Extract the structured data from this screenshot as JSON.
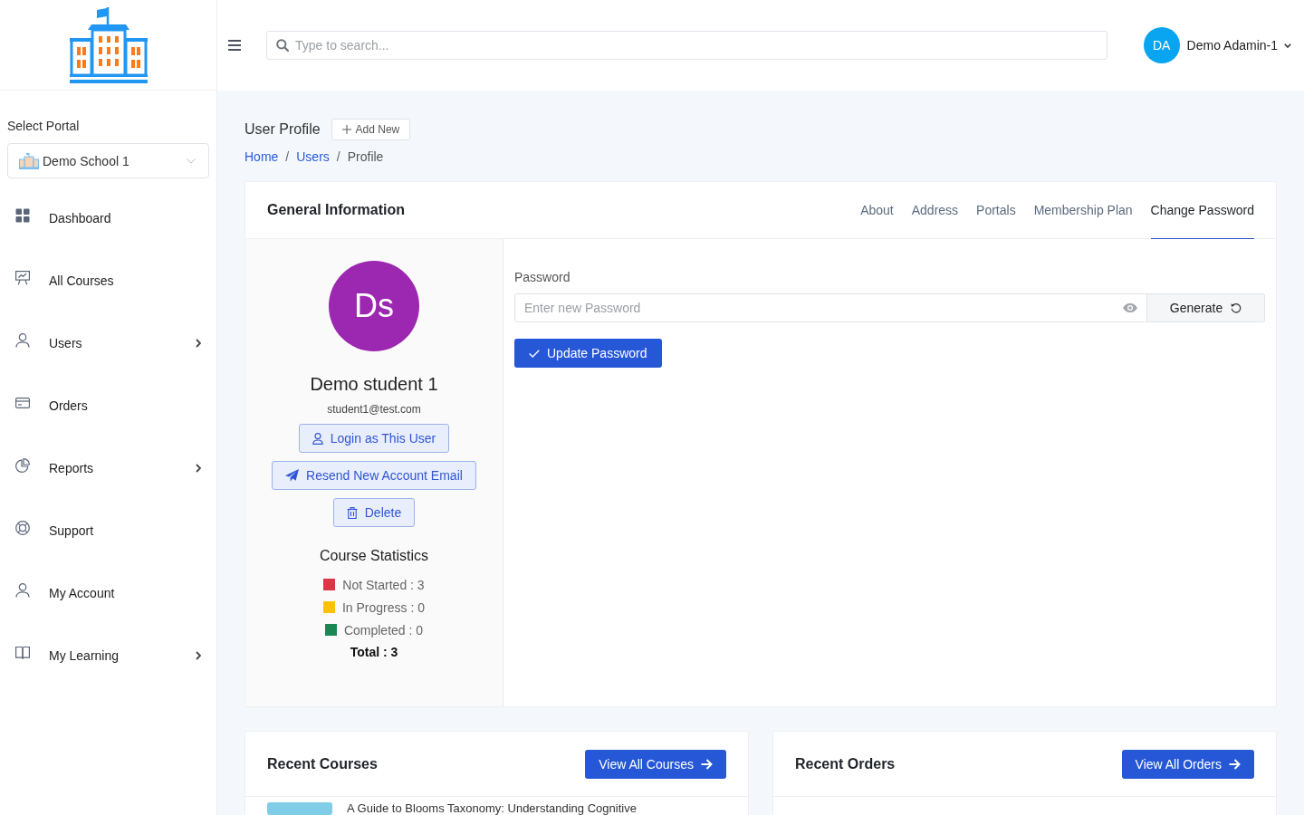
{
  "sidebar": {
    "portal_label": "Select Portal",
    "portal_select": {
      "value": "Demo School 1"
    },
    "items": [
      {
        "label": "Dashboard",
        "submenu": false
      },
      {
        "label": "All Courses",
        "submenu": false
      },
      {
        "label": "Users",
        "submenu": true
      },
      {
        "label": "Orders",
        "submenu": false
      },
      {
        "label": "Reports",
        "submenu": true
      },
      {
        "label": "Support",
        "submenu": false
      },
      {
        "label": "My Account",
        "submenu": false
      },
      {
        "label": "My Learning",
        "submenu": true
      }
    ]
  },
  "header": {
    "search": {
      "placeholder": "Type to search..."
    },
    "user": {
      "initials": "DA",
      "name": "Demo Adamin-1"
    }
  },
  "page": {
    "title": "User Profile",
    "add_button": "Add New",
    "breadcrumb": [
      {
        "label": "Home",
        "current": false
      },
      {
        "separator": "/",
        "label": "Users",
        "current": false
      },
      {
        "separator": "/",
        "label": "Profile",
        "current": true
      }
    ]
  },
  "profile_card": {
    "title": "General Information",
    "tabs": [
      {
        "label": "About",
        "selected": false
      },
      {
        "label": "Address",
        "selected": false
      },
      {
        "label": "Portals",
        "selected": false
      },
      {
        "label": "Membership Plan",
        "selected": false
      },
      {
        "label": "Change Password",
        "selected": true
      }
    ],
    "user": {
      "initials": "Ds",
      "name": "Demo student 1",
      "email": "student1@test.com"
    },
    "actions": [
      {
        "kind": "login",
        "label": "Login as This User"
      },
      {
        "kind": "resend",
        "label": "Resend New Account Email"
      },
      {
        "kind": "delete",
        "label": "Delete"
      }
    ],
    "statistics": {
      "title": "Course Statistics",
      "items": [
        {
          "label": "Not Started : 3",
          "color": "#dc3545"
        },
        {
          "label": "In Progress : 0",
          "color": "#ffc107"
        },
        {
          "label": "Completed : 0",
          "color": "#198754"
        }
      ],
      "total": "Total : 3"
    },
    "password_form": {
      "label": "Password",
      "placeholder": "Enter new Password",
      "generate_button": "Generate",
      "submit_button": "Update Password"
    }
  },
  "recent_panels": [
    {
      "title": "Recent Courses",
      "button": "View All Courses",
      "rows": [
        {
          "title": "A Guide to Blooms Taxonomy: Understanding Cognitive"
        }
      ]
    },
    {
      "title": "Recent Orders",
      "button": "View All Orders"
    }
  ]
}
